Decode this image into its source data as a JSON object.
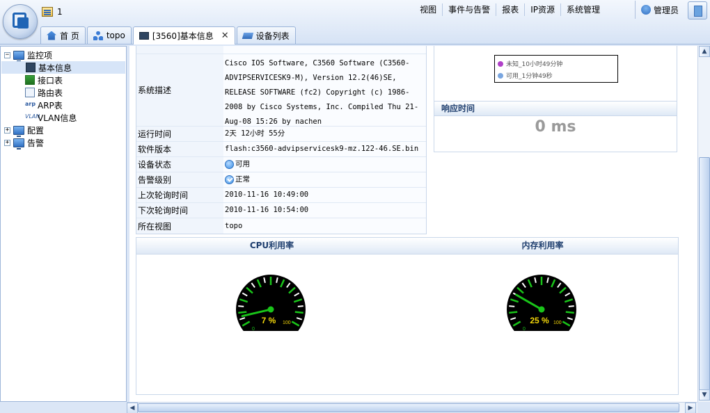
{
  "header": {
    "notification_count": "1",
    "nav": [
      "视图",
      "事件与告警",
      "报表",
      "IP资源",
      "系统管理"
    ],
    "user": "管理员"
  },
  "tabs": [
    {
      "label": "首 页",
      "icon": "home-icon"
    },
    {
      "label": "topo",
      "icon": "topology-icon"
    },
    {
      "label": "[3560]基本信息",
      "icon": "device-icon",
      "active": true,
      "close": "✕"
    },
    {
      "label": "设备列表",
      "icon": "device-list-icon"
    }
  ],
  "sidebar": {
    "root": "监控项",
    "items": [
      "基本信息",
      "接口表",
      "路由表",
      "ARP表",
      "VLAN信息"
    ],
    "groups": [
      "配置",
      "告警"
    ],
    "icon_labels": {
      "arp": "arp",
      "vlan": "VLAN"
    }
  },
  "info": {
    "rows": [
      {
        "label": "系统描述",
        "value": "Cisco IOS Software, C3560 Software (C3560-ADVIPSERVICESK9-M), Version 12.2(46)SE, RELEASE SOFTWARE (fc2) Copyright (c) 1986-2008 by Cisco Systems, Inc. Compiled Thu 21-Aug-08 15:26 by nachen"
      },
      {
        "label": "运行时间",
        "value": "2天 12小时 55分"
      },
      {
        "label": "软件版本",
        "value": "flash:c3560-advipservicesk9-mz.122-46.SE.bin"
      },
      {
        "label": "设备状态",
        "value": "可用"
      },
      {
        "label": "告警级别",
        "value": "正常"
      },
      {
        "label": "上次轮询时间",
        "value": "2010-11-16 10:49:00"
      },
      {
        "label": "下次轮询时间",
        "value": "2010-11-16 10:54:00"
      },
      {
        "label": "所在视图",
        "value": "topo"
      }
    ]
  },
  "availability_legend": {
    "items": [
      {
        "label": "未知_10小时49分钟",
        "color": "#b040c8"
      },
      {
        "label": "可用_1分钟49秒",
        "color": "#7aa6e0"
      }
    ]
  },
  "response_time": {
    "title": "响应时间",
    "value": "0 ms"
  },
  "gauges": {
    "cpu": {
      "title": "CPU利用率",
      "value": 7,
      "label": "7 %",
      "max_label": "100",
      "min_label": "0"
    },
    "memory": {
      "title": "内存利用率",
      "value": 25,
      "label": "25 %",
      "max_label": "100",
      "min_label": "0"
    }
  },
  "colors": {
    "accent": "#1e3e6e",
    "gauge_green": "#19c419",
    "gauge_label": "#f2d60a"
  }
}
